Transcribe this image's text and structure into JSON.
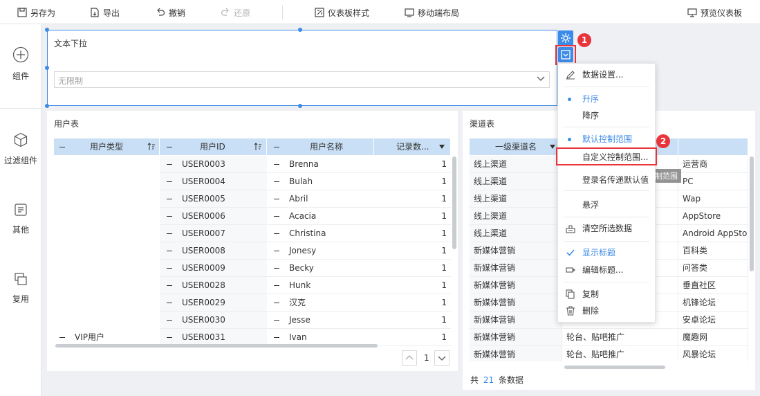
{
  "toolbar": {
    "save_as": "另存为",
    "export": "导出",
    "undo": "撤销",
    "redo": "还原",
    "dashboard_style": "仪表板样式",
    "mobile_layout": "移动端布局",
    "preview": "预览仪表板"
  },
  "left_panel": {
    "items": [
      {
        "label": "组件",
        "icon": "plus-circle-icon"
      },
      {
        "label": "过滤组件",
        "icon": "cube-icon"
      },
      {
        "label": "其他",
        "icon": "document-icon"
      },
      {
        "label": "复用",
        "icon": "layers-icon"
      }
    ]
  },
  "filter_widget": {
    "title": "文本下拉",
    "placeholder": "无限制"
  },
  "markers": {
    "m1": "1",
    "m2": "2"
  },
  "user_table": {
    "title": "用户表",
    "columns": [
      "用户类型",
      "用户ID",
      "用户名称",
      "记录数..."
    ],
    "rows": [
      {
        "type": "",
        "id": "USER0003",
        "name": "Brenna",
        "count": "1"
      },
      {
        "type": "",
        "id": "USER0004",
        "name": "Bulah",
        "count": "1"
      },
      {
        "type": "",
        "id": "USER0005",
        "name": "Abril",
        "count": "1"
      },
      {
        "type": "",
        "id": "USER0006",
        "name": "Acacia",
        "count": "1"
      },
      {
        "type": "",
        "id": "USER0007",
        "name": "Christina",
        "count": "1"
      },
      {
        "type": "",
        "id": "USER0008",
        "name": "Jonesy",
        "count": "1"
      },
      {
        "type": "",
        "id": "USER0009",
        "name": "Becky",
        "count": "1"
      },
      {
        "type": "",
        "id": "USER0028",
        "name": "Hunk",
        "count": "1"
      },
      {
        "type": "",
        "id": "USER0029",
        "name": "汉克",
        "count": "1"
      },
      {
        "type": "",
        "id": "USER0030",
        "name": "Jesse",
        "count": "1"
      },
      {
        "type": "VIP用户",
        "id": "USER0031",
        "name": "Ivan",
        "count": "1"
      }
    ],
    "page": "1"
  },
  "channel_table": {
    "title": "渠道表",
    "columns": [
      "一级渠道名",
      "",
      ""
    ],
    "rows": [
      {
        "c1": "线上渠道",
        "c2": "",
        "c3": "运营商"
      },
      {
        "c1": "线上渠道",
        "c2": "",
        "c3": "PC"
      },
      {
        "c1": "线上渠道",
        "c2": "",
        "c3": "Wap"
      },
      {
        "c1": "线上渠道",
        "c2": "",
        "c3": "AppStore"
      },
      {
        "c1": "线上渠道",
        "c2": "",
        "c3": "Android AppStore"
      },
      {
        "c1": "新媒体营销",
        "c2": "",
        "c3": "百科类"
      },
      {
        "c1": "新媒体营销",
        "c2": "",
        "c3": "问答类"
      },
      {
        "c1": "新媒体营销",
        "c2": "",
        "c3": "垂直社区"
      },
      {
        "c1": "新媒体营销",
        "c2": "",
        "c3": "机锋论坛"
      },
      {
        "c1": "新媒体营销",
        "c2": "",
        "c3": "安卓论坛"
      },
      {
        "c1": "新媒体营销",
        "c2": "轮台、贴吧推广",
        "c3": "魔趣网"
      },
      {
        "c1": "新媒体营销",
        "c2": "轮台、贴吧推广",
        "c3": "风暴论坛"
      }
    ],
    "footer_prefix": "共",
    "footer_count": "21",
    "footer_suffix": "条数据"
  },
  "context_menu": {
    "data_settings": "数据设置...",
    "ascending": "升序",
    "descending": "降序",
    "default_range": "默认控制范围",
    "custom_range": "自定义控制范围...",
    "login_default": "登录名传递默认值",
    "float": "悬浮",
    "clear_selection": "清空所选数据",
    "show_title": "显示标题",
    "edit_title": "编辑标题...",
    "copy": "复制",
    "delete": "删除"
  },
  "tooltip": "自定义控制范围",
  "colors": {
    "accent": "#3d8be8",
    "marker": "#e8343a",
    "header": "#c9dff5"
  }
}
